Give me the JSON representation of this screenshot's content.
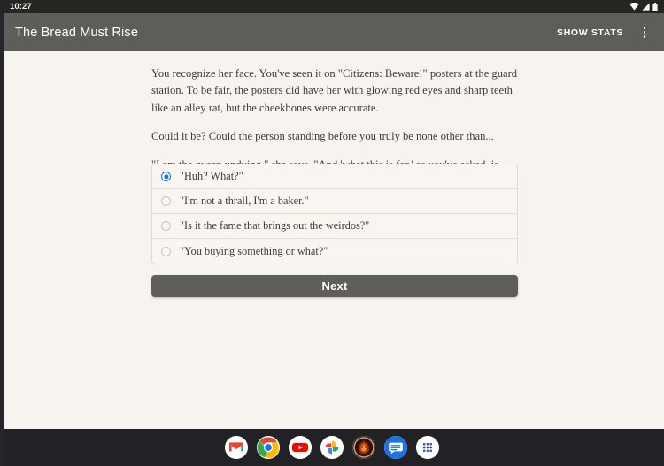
{
  "status_bar": {
    "time": "10:27",
    "icons": [
      "wifi-icon",
      "cell-signal-icon",
      "battery-icon"
    ]
  },
  "app_bar": {
    "title": "The Bread Must Rise",
    "show_stats_label": "SHOW STATS",
    "overflow_label": "",
    "background_color": "#5f5d59"
  },
  "story": {
    "paragraphs": [
      "You recognize her face. You've seen it on \"Citizens: Beware!\" posters at the guard station. To be fair, the posters did have her with glowing red eyes and sharp teeth like an alley rat, but the cheekbones were accurate.",
      "Could it be? Could the person standing before you truly be none other than...",
      "\"I am the queen undying,\" she says. \"And 'what this is for,' as you've asked, is you've accepted delivery of myself as your mistress, making you my thrall.\""
    ]
  },
  "choices": {
    "selected_index": 0,
    "accent_color": "#1a73e8",
    "items": [
      {
        "label": "\"Huh? What?\""
      },
      {
        "label": "\"I'm not a thrall, I'm a baker.\""
      },
      {
        "label": "\"Is it the fame that brings out the weirdos?\""
      },
      {
        "label": "\"You buying something or what?\""
      }
    ]
  },
  "next_button": {
    "label": "Next",
    "background_color": "#605e5a"
  },
  "dock": {
    "items": [
      {
        "name": "gmail-icon",
        "label": "Gmail"
      },
      {
        "name": "chrome-icon",
        "label": "Chrome"
      },
      {
        "name": "youtube-icon",
        "label": "YouTube"
      },
      {
        "name": "google-photos-icon",
        "label": "Photos"
      },
      {
        "name": "game-app-icon",
        "label": "Game"
      },
      {
        "name": "messages-icon",
        "label": "Messages"
      },
      {
        "name": "app-drawer-icon",
        "label": "All apps"
      }
    ]
  }
}
